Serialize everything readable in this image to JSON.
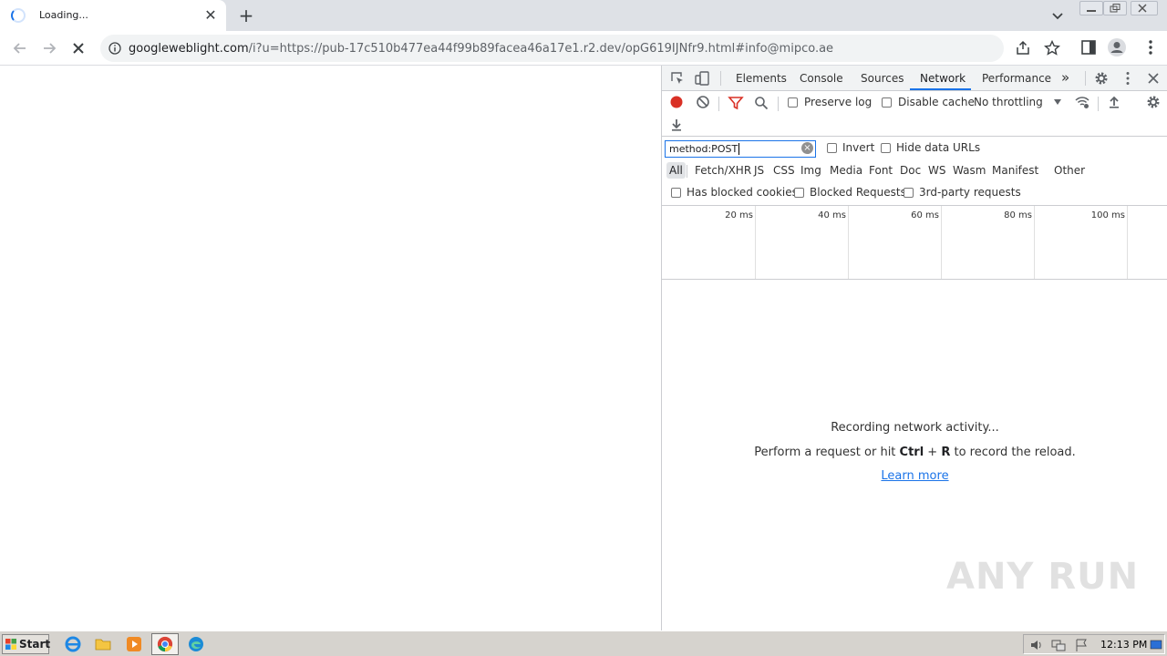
{
  "browser": {
    "tab_title": "Loading...",
    "tab_close": "✕",
    "new_tab": "+",
    "url_host": "googleweblight.com",
    "url_rest": "/i?u=https://pub-17c510b477ea44f99b89facea46a17e1.r2.dev/opG619IJNfr9.html#info@mipco.ae"
  },
  "devtools": {
    "tabs": [
      "Elements",
      "Console",
      "Sources",
      "Network",
      "Performance"
    ],
    "active_tab": "Network",
    "more_tabs": "»",
    "preserve_log": "Preserve log",
    "disable_cache": "Disable cache",
    "throttling": "No throttling",
    "filter_value": "method:POST",
    "invert": "Invert",
    "hide_data_urls": "Hide data URLs",
    "types": [
      "All",
      "Fetch/XHR",
      "JS",
      "CSS",
      "Img",
      "Media",
      "Font",
      "Doc",
      "WS",
      "Wasm",
      "Manifest",
      "Other"
    ],
    "active_type": "All",
    "has_blocked_cookies": "Has blocked cookies",
    "blocked_requests": "Blocked Requests",
    "third_party": "3rd-party requests",
    "timeline_ticks": [
      "20 ms",
      "40 ms",
      "60 ms",
      "80 ms",
      "100 ms"
    ],
    "empty_title": "Recording network activity...",
    "empty_hint_pre": "Perform a request or hit ",
    "empty_hint_key1": "Ctrl",
    "empty_hint_plus": " + ",
    "empty_hint_key2": "R",
    "empty_hint_post": " to record the reload.",
    "learn_more": "Learn more"
  },
  "watermark": "ANY RUN",
  "taskbar": {
    "start": "Start",
    "clock": "12:13 PM"
  },
  "colors": {
    "record_red": "#d93025",
    "filter_red": "#d93025",
    "accent_blue": "#1a73e8"
  }
}
